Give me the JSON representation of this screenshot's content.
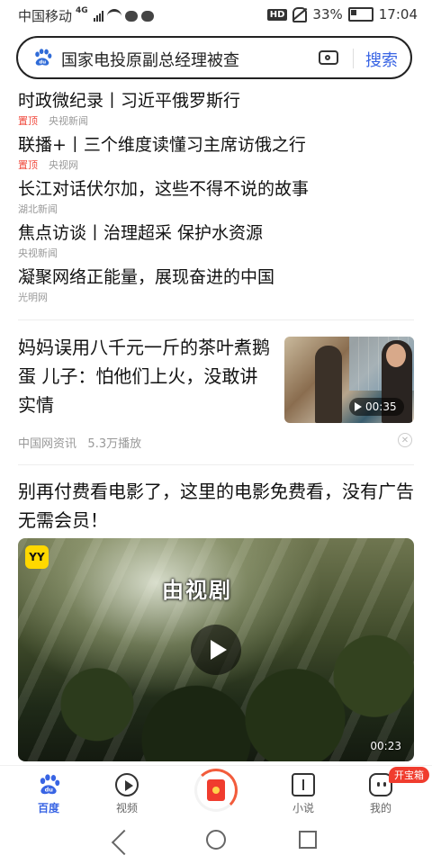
{
  "status_bar": {
    "carrier": "中国移动",
    "network": "4G",
    "hd": "HD",
    "battery": "33%",
    "time": "17:04"
  },
  "search": {
    "query": "国家电投原副总经理被查",
    "button": "搜索",
    "logo_icon": "baidu-paw-icon",
    "camera_icon": "camera-icon"
  },
  "hot_list": [
    {
      "title": "时政微纪录丨习近平俄罗斯行",
      "pin": "置顶",
      "source": "央视新闻"
    },
    {
      "title": "联播+丨三个维度读懂习主席访俄之行",
      "pin": "置顶",
      "source": "央视网"
    },
    {
      "title": "长江对话伏尔加，这些不得不说的故事",
      "pin": "",
      "source": "湖北新闻"
    },
    {
      "title": "焦点访谈丨治理超采 保护水资源",
      "pin": "",
      "source": "央视新闻"
    },
    {
      "title": "凝聚网络正能量，展现奋进的中国",
      "pin": "",
      "source": "光明网"
    }
  ],
  "news1": {
    "title": "妈妈误用八千元一斤的茶叶煮鹅蛋 儿子：怕他们上火，没敢讲实情",
    "duration": "00:35",
    "source": "中国网资讯",
    "plays": "5.3万播放"
  },
  "news2": {
    "title": "别再付费看电影了，这里的电影免费看，没有广告无需会员！",
    "overlay_text": "由视剧",
    "brand": "YY",
    "duration": "00:23"
  },
  "bottom_nav": {
    "tabs": [
      {
        "label": "百度",
        "icon": "baidu-paw-icon",
        "active": true
      },
      {
        "label": "视频",
        "icon": "play-circle-icon",
        "active": false
      },
      {
        "label": "小说",
        "icon": "book-icon",
        "active": false
      },
      {
        "label": "我的",
        "icon": "smile-face-icon",
        "active": false
      }
    ],
    "badge": "开宝箱",
    "center_icon": "red-envelope-icon"
  },
  "colors": {
    "accent": "#3864e4",
    "pin_red": "#f04a3e"
  }
}
